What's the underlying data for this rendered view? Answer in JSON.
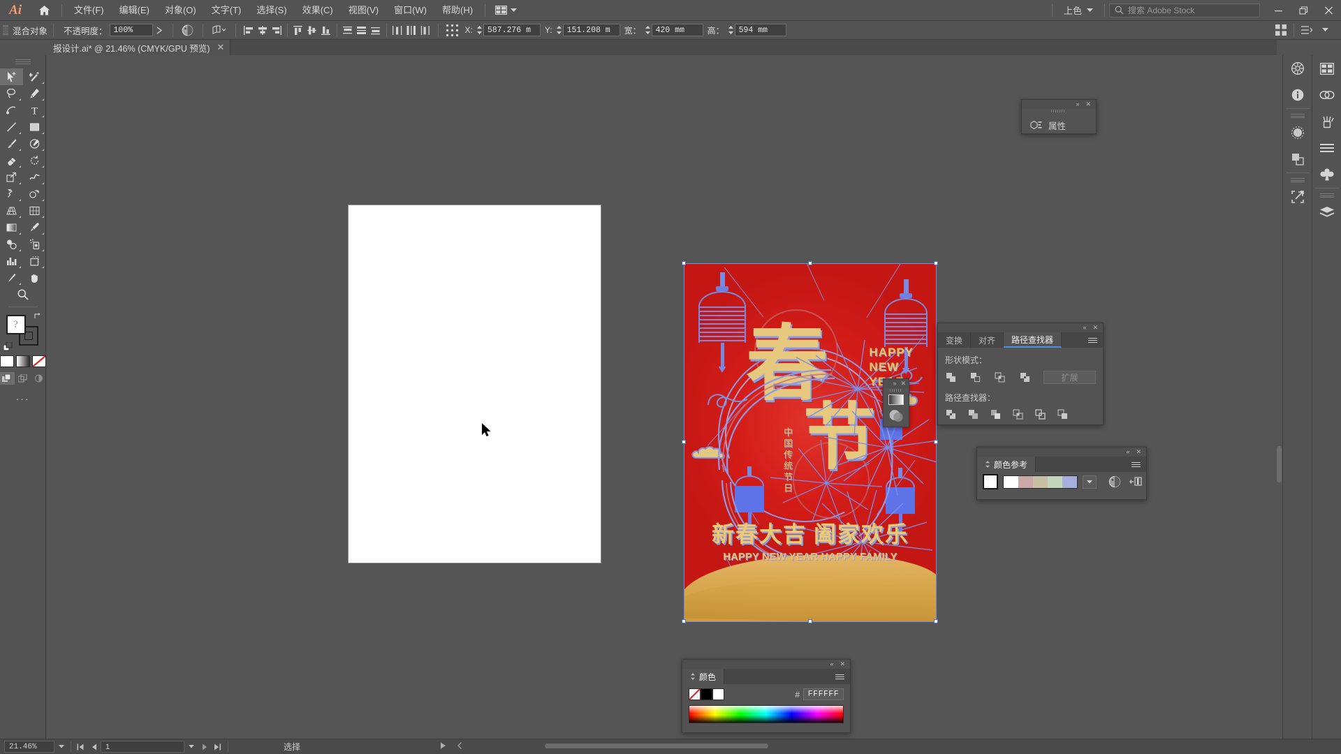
{
  "app": {
    "name": "Adobe Illustrator",
    "logo_text": "Ai",
    "home_icon": "home-icon"
  },
  "menubar": {
    "items": [
      {
        "label": "文件(F)",
        "name": "menu-file"
      },
      {
        "label": "编辑(E)",
        "name": "menu-edit"
      },
      {
        "label": "对象(O)",
        "name": "menu-object"
      },
      {
        "label": "文字(T)",
        "name": "menu-type"
      },
      {
        "label": "选择(S)",
        "name": "menu-select"
      },
      {
        "label": "效果(C)",
        "name": "menu-effect"
      },
      {
        "label": "视图(V)",
        "name": "menu-view"
      },
      {
        "label": "窗口(W)",
        "name": "menu-window"
      },
      {
        "label": "帮助(H)",
        "name": "menu-help"
      }
    ],
    "workspace_switcher_icon": "workspace-switcher-icon",
    "color_mode": "上色",
    "stock_search_placeholder": "搜索 Adobe Stock",
    "window_minimize": "—",
    "window_restore": "❐",
    "window_close": "✕"
  },
  "controlbar": {
    "object_type": "混合对象",
    "opacity_label": "不透明度：",
    "opacity_value": "100%",
    "x_label": "X:",
    "x_value": "587.276 m",
    "y_label": "Y:",
    "y_value": "151.208 m",
    "w_label": "宽：",
    "w_value": "420 mm",
    "h_label": "高：",
    "h_value": "594 mm",
    "align_icons": [
      "align-left-icon",
      "align-center-horizontal-icon",
      "align-right-icon",
      "align-top-icon",
      "align-center-vertical-icon",
      "align-bottom-icon",
      "distribute-top-icon",
      "distribute-center-v-icon",
      "distribute-bottom-icon",
      "distribute-left-icon",
      "distribute-center-h-icon",
      "distribute-right-icon"
    ],
    "transform_icon": "transform-proxy-icon",
    "arrange_icon": "arrange-icon",
    "recolor_icon": "recolor-artwork-icon"
  },
  "tabbar": {
    "document_title": "报设计.ai* @ 21.46% (CMYK/GPU 预览)",
    "close_label": "✕"
  },
  "toolbar": {
    "tools": [
      {
        "name": "selection-tool",
        "glyph": "➤"
      },
      {
        "name": "magic-wand-tool",
        "glyph": "✨"
      },
      {
        "name": "lasso-tool",
        "glyph": "◌"
      },
      {
        "name": "pen-tool",
        "glyph": "✒"
      },
      {
        "name": "curvature-tool",
        "glyph": "〰"
      },
      {
        "name": "type-tool",
        "glyph": "T"
      },
      {
        "name": "line-segment-tool",
        "glyph": "／"
      },
      {
        "name": "rectangle-tool",
        "glyph": "▭"
      },
      {
        "name": "paintbrush-tool",
        "glyph": "🖌"
      },
      {
        "name": "shaper-tool",
        "glyph": "◔"
      },
      {
        "name": "eraser-tool",
        "glyph": "◨"
      },
      {
        "name": "rotate-tool",
        "glyph": "↻"
      },
      {
        "name": "scale-tool",
        "glyph": "⤢"
      },
      {
        "name": "width-tool",
        "glyph": "≋"
      },
      {
        "name": "free-transform-tool",
        "glyph": "✥"
      },
      {
        "name": "shape-builder-tool",
        "glyph": "◕"
      },
      {
        "name": "perspective-grid-tool",
        "glyph": "▧"
      },
      {
        "name": "mesh-tool",
        "glyph": "▨"
      },
      {
        "name": "gradient-tool",
        "glyph": "▩"
      },
      {
        "name": "eyedropper-tool",
        "glyph": "⟋"
      },
      {
        "name": "blend-tool",
        "glyph": "◍"
      },
      {
        "name": "symbol-sprayer-tool",
        "glyph": "⁂"
      },
      {
        "name": "column-graph-tool",
        "glyph": "▥"
      },
      {
        "name": "artboard-tool",
        "glyph": "⊐"
      },
      {
        "name": "slice-tool",
        "glyph": "✎"
      },
      {
        "name": "hand-tool",
        "glyph": "✋"
      },
      {
        "name": "zoom-tool",
        "glyph": "🔍"
      }
    ],
    "fill_color": "#FFFFFF",
    "stroke_color": "#535353",
    "color_buttons": [
      "color-swatch-white",
      "gradient-swatch",
      "none-swatch"
    ],
    "draw_modes": [
      "draw-normal-mode",
      "draw-behind-mode",
      "draw-inside-mode"
    ],
    "more_tools": "···"
  },
  "panels": {
    "properties": {
      "title": "属性",
      "icon": "properties-icon",
      "collapse": "»",
      "close": "✕"
    },
    "pathfinder": {
      "tabs": [
        {
          "label": "变换",
          "name": "tab-transform",
          "active": false
        },
        {
          "label": "对齐",
          "name": "tab-align",
          "active": false
        },
        {
          "label": "路径查找器",
          "name": "tab-pathfinder",
          "active": true
        }
      ],
      "shape_modes_label": "形状模式：",
      "shape_mode_buttons": [
        "unite-icon",
        "minus-front-icon",
        "intersect-icon",
        "exclude-icon"
      ],
      "expand_label": "扩展",
      "pathfinders_label": "路径查找器：",
      "pathfinder_buttons": [
        "divide-icon",
        "trim-icon",
        "merge-icon",
        "crop-icon",
        "outline-icon",
        "minus-back-icon"
      ],
      "collapse": "«",
      "close": "✕"
    },
    "color_guide": {
      "title": "颜色参考",
      "active_color": "#FFFFFF",
      "swatches": [
        "#FFFFFF",
        "#C9A8A8",
        "#C6BFA4",
        "#C2D6BC",
        "#A8AEDC"
      ],
      "dropdown_icon": "chevron-down-icon",
      "edit_colors_icon": "edit-colors-icon",
      "limit_colors_icon": "limit-colors-icon",
      "collapse": "«",
      "close": "✕"
    },
    "color": {
      "title": "颜色",
      "none_swatch": "none-swatch",
      "stroke_swatch": "#000000",
      "fill_swatch": "#FFFFFF",
      "hash_label": "#",
      "hex_value": "FFFFFF",
      "collapse": "«",
      "close": "✕"
    },
    "mini": {
      "gradient_icon": "gradient-icon",
      "transparency_icon": "transparency-icon",
      "collapse": "»",
      "close": "✕"
    }
  },
  "dock": {
    "inner_buttons": [
      {
        "name": "libraries-icon",
        "glyph": "❂"
      },
      {
        "name": "info-icon",
        "glyph": "ⓘ"
      },
      {
        "name": "brushes-round-icon",
        "glyph": "◉"
      },
      {
        "name": "pathfinder-dock-icon",
        "glyph": "❏"
      },
      {
        "name": "export-icon",
        "glyph": "⇱"
      }
    ],
    "outer_buttons": [
      {
        "name": "artboards-icon",
        "glyph": "▦"
      },
      {
        "name": "links-icon",
        "glyph": "∞"
      },
      {
        "name": "brushes-icon",
        "glyph": "🖌"
      },
      {
        "name": "align-dock-icon",
        "glyph": "≡"
      },
      {
        "name": "symbols-icon",
        "glyph": "♣"
      },
      {
        "name": "layers-icon",
        "glyph": "◈"
      }
    ]
  },
  "statusbar": {
    "zoom_value": "21.46%",
    "zoom_dropdown": "chevron-down-icon",
    "first_page_icon": "first-artboard-icon",
    "prev_page_icon": "prev-artboard-icon",
    "page_value": "1",
    "page_dropdown": "chevron-down-icon",
    "next_page_icon": "next-artboard-icon",
    "last_page_icon": "last-artboard-icon",
    "status_text": "选择",
    "play_icon": "play-icon",
    "back_icon": "back-icon"
  },
  "artwork": {
    "name": "chinese-new-year-poster",
    "background_color": "#D81E1A",
    "gold_color": "#E3B769",
    "blue_color": "#7A8AE0",
    "hero_characters": [
      "春",
      "节"
    ],
    "happy_new_year": [
      "HAPPY",
      "NEW",
      "YEAR"
    ],
    "vertical_text": "中国传统节日",
    "headline_cn": "新春大吉 阖家欢乐",
    "headline_en": "HAPPY NEW YEAR HAPPY FAMILY",
    "artboard_blank_name": "empty-artboard"
  }
}
